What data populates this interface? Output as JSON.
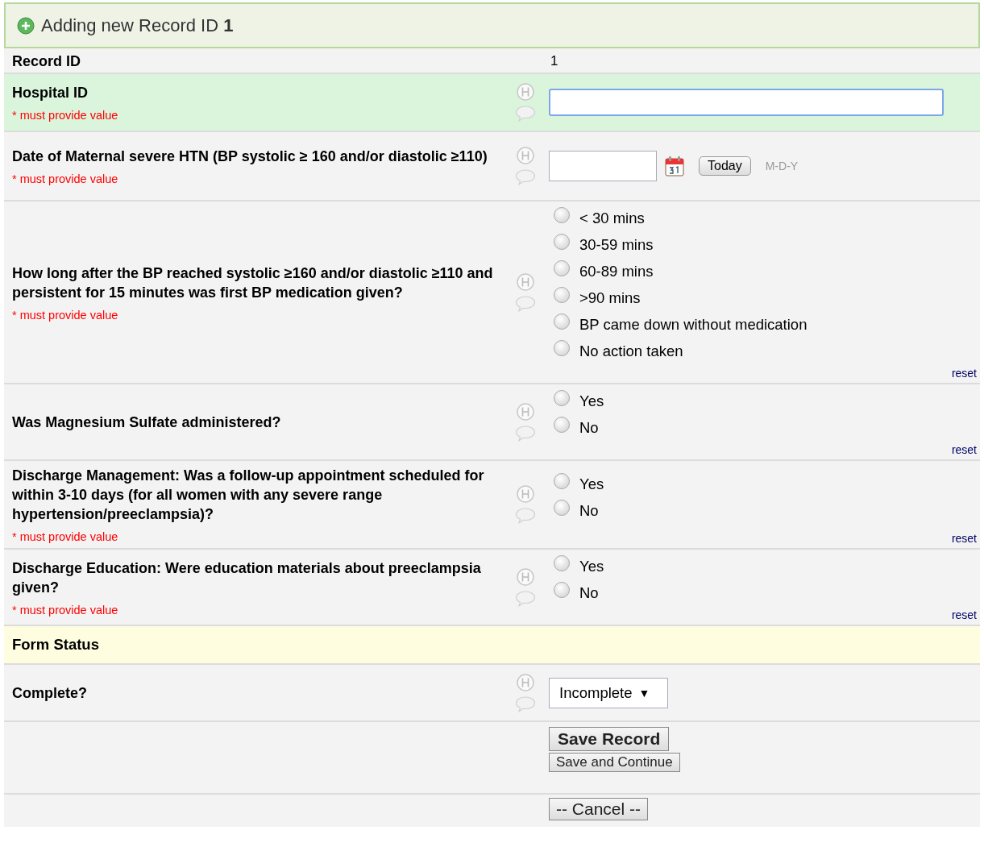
{
  "header": {
    "title": "Adding new Record ID **1**"
  },
  "fields": [
    {
      "kind": "readonly",
      "label": "Record ID",
      "value": "1"
    },
    {
      "kind": "text",
      "label": "Hospital ID",
      "required": "* must provide value",
      "highlighted": true,
      "focused": true
    },
    {
      "kind": "date",
      "label": "Date of Maternal severe HTN (BP systolic ≥ 160 and/or diastolic ≥110)",
      "required": "* must provide value",
      "today": "Today",
      "format": "M-D-Y"
    },
    {
      "kind": "radio",
      "label": "How long after the BP reached systolic ≥160 and/or diastolic ≥110 and persistent for 15 minutes was first BP medication given?",
      "required": "* must provide value",
      "reset": "reset",
      "options": [
        {
          "label": "< 30 mins",
          "selected": false
        },
        {
          "label": "30-59 mins",
          "selected": false
        },
        {
          "label": "60-89 mins",
          "selected": false
        },
        {
          "label": ">90 mins",
          "selected": false
        },
        {
          "label": "BP came down without medication",
          "selected": false
        },
        {
          "label": "No action taken",
          "selected": false
        }
      ]
    },
    {
      "kind": "radio",
      "label": "Was Magnesium Sulfate administered?",
      "reset": "reset",
      "options": [
        {
          "label": "Yes",
          "selected": false
        },
        {
          "label": "No",
          "selected": false
        }
      ]
    },
    {
      "kind": "radio",
      "label": "Discharge Management: Was a follow-up appointment scheduled for within 3-10 days (for all women with any severe range hypertension/preeclampsia)?",
      "required": "* must provide value",
      "reset": "reset",
      "options": [
        {
          "label": "Yes",
          "selected": false
        },
        {
          "label": "No",
          "selected": false
        }
      ]
    },
    {
      "kind": "radio",
      "label": "Discharge Education: Were education materials about preeclampsia given?",
      "required": "* must provide value",
      "reset": "reset",
      "options": [
        {
          "label": "Yes",
          "selected": false
        },
        {
          "label": "No",
          "selected": false
        }
      ]
    },
    {
      "kind": "section",
      "label": "Form Status"
    },
    {
      "kind": "select",
      "label": "Complete?",
      "value": "Incomplete",
      "arrow": "▼"
    },
    {
      "kind": "buttons",
      "buttons": [
        {
          "label": "Save Record",
          "primary": true
        },
        {
          "label": "Save and Continue",
          "primary": false
        }
      ]
    },
    {
      "kind": "buttons",
      "buttons": [
        {
          "label": "-- Cancel --",
          "primary": false
        }
      ]
    }
  ]
}
